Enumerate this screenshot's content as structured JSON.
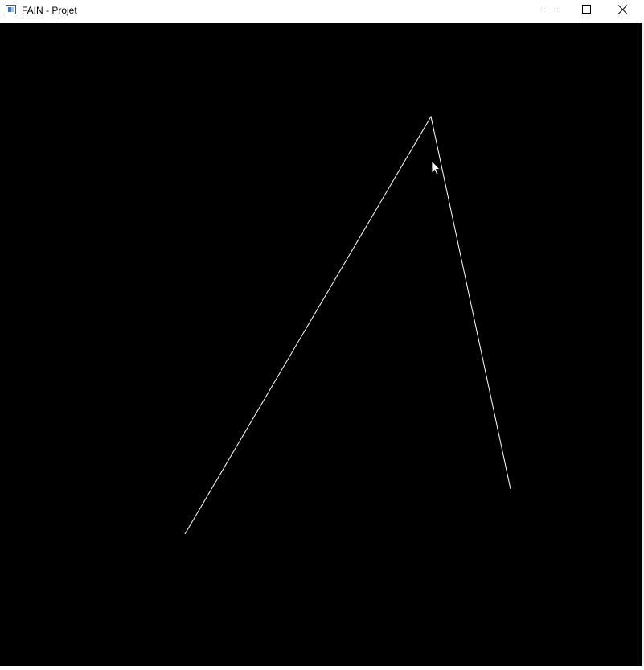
{
  "window": {
    "title": "FAIN - Projet",
    "icon": "app-window-icon"
  },
  "controls": {
    "minimize_icon": "minimize-icon",
    "maximize_icon": "maximize-icon",
    "close_icon": "close-icon"
  },
  "canvas": {
    "background": "#000000",
    "stroke_color": "#ffffff",
    "polyline_point_count": 3,
    "cursor_icon": "arrow-cursor-icon"
  },
  "colors": {
    "titlebar_bg": "#ffffff",
    "title_text": "#000000"
  }
}
